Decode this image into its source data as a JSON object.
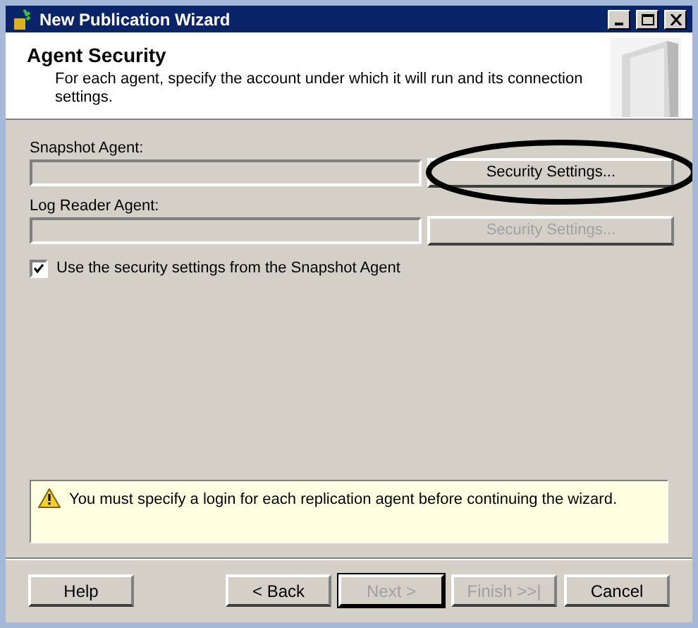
{
  "window": {
    "title": "New Publication Wizard"
  },
  "header": {
    "title": "Agent Security",
    "description": "For each agent, specify the account under which it will run and its connection settings."
  },
  "agents": [
    {
      "label": "Snapshot Agent:",
      "button": "Security Settings...",
      "disabled": false,
      "highlighted": true
    },
    {
      "label": "Log Reader Agent:",
      "button": "Security Settings...",
      "disabled": true,
      "highlighted": false
    }
  ],
  "use_snapshot_settings": {
    "label": "Use the security settings from the Snapshot Agent",
    "checked": true
  },
  "message": {
    "kind": "warning",
    "text": "You must specify a login for each replication agent before continuing the wizard."
  },
  "buttons": [
    {
      "label": "Help",
      "disabled": false,
      "default": false
    },
    {
      "label": "< Back",
      "disabled": false,
      "default": false
    },
    {
      "label": "Next >",
      "disabled": true,
      "default": true
    },
    {
      "label": "Finish >>|",
      "disabled": true,
      "default": false
    },
    {
      "label": "Cancel",
      "disabled": false,
      "default": false
    }
  ]
}
